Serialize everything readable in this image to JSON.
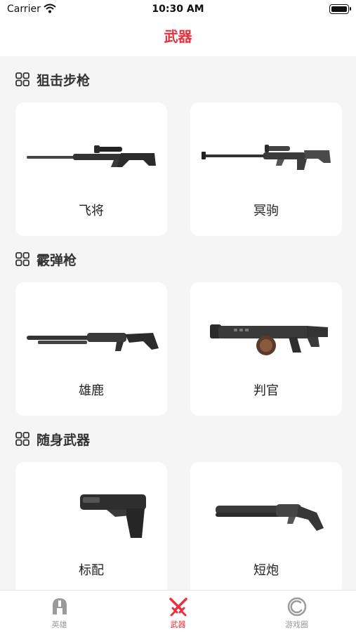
{
  "status_bar": {
    "carrier": "Carrier",
    "time": "10:30 AM"
  },
  "nav": {
    "title": "武器"
  },
  "sections": [
    {
      "title": "狙击步枪",
      "items": [
        {
          "name": "飞将",
          "icon": "sniper-rifle-icon"
        },
        {
          "name": "冥驹",
          "icon": "heavy-sniper-icon"
        }
      ]
    },
    {
      "title": "霰弹枪",
      "items": [
        {
          "name": "雄鹿",
          "icon": "pump-shotgun-icon"
        },
        {
          "name": "判官",
          "icon": "drum-shotgun-icon"
        }
      ]
    },
    {
      "title": "随身武器",
      "items": [
        {
          "name": "标配",
          "icon": "pistol-icon"
        },
        {
          "name": "短炮",
          "icon": "sawed-off-shotgun-icon"
        }
      ]
    }
  ],
  "tabs": [
    {
      "label": "英雄",
      "icon": "helmet-icon",
      "active": false
    },
    {
      "label": "武器",
      "icon": "crossed-swords-icon",
      "active": true
    },
    {
      "label": "游戏圈",
      "icon": "circle-icon",
      "active": false
    }
  ],
  "colors": {
    "accent": "#e8313f",
    "inactive": "#9a9a9a",
    "background": "#f5f5f5"
  }
}
